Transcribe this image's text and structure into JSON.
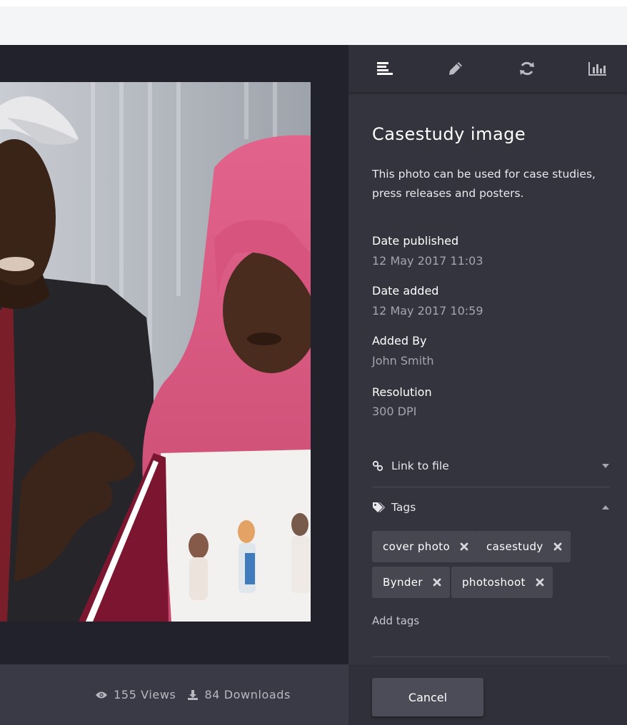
{
  "panel": {
    "tabs": [
      {
        "name": "info",
        "icon": "align-left-icon"
      },
      {
        "name": "edit",
        "icon": "pencil-icon"
      },
      {
        "name": "versions",
        "icon": "refresh-icon"
      },
      {
        "name": "analytics",
        "icon": "bar-chart-icon"
      }
    ],
    "title": "Casestudy image",
    "description": "This photo can be used for case studies, press releases and posters.",
    "meta": [
      {
        "label": "Date published",
        "value": "12 May  2017 11:03"
      },
      {
        "label": "Date added",
        "value": "12 May  2017 10:59"
      },
      {
        "label": "Added By",
        "value": "John Smith"
      },
      {
        "label": "Resolution",
        "value": "300 DPI"
      }
    ],
    "link_section": {
      "label": "Link to file",
      "icon": "link-icon",
      "state": "collapsed"
    },
    "tags_section": {
      "label": "Tags",
      "icon": "tags-icon",
      "state": "expanded"
    },
    "tags": [
      "cover photo",
      "casestudy",
      "Bynder",
      "photoshoot"
    ],
    "add_tags_label": "Add tags"
  },
  "stats": {
    "views": "155 Views",
    "downloads": "84 Downloads"
  },
  "actions": {
    "cancel_label": "Cancel"
  },
  "colors": {
    "viewer_bg": "#22222c",
    "panel_bg": "#33343e",
    "tag_bg": "#464751",
    "button_bg": "#4b4c57",
    "page_bg": "#f4f5f7"
  }
}
